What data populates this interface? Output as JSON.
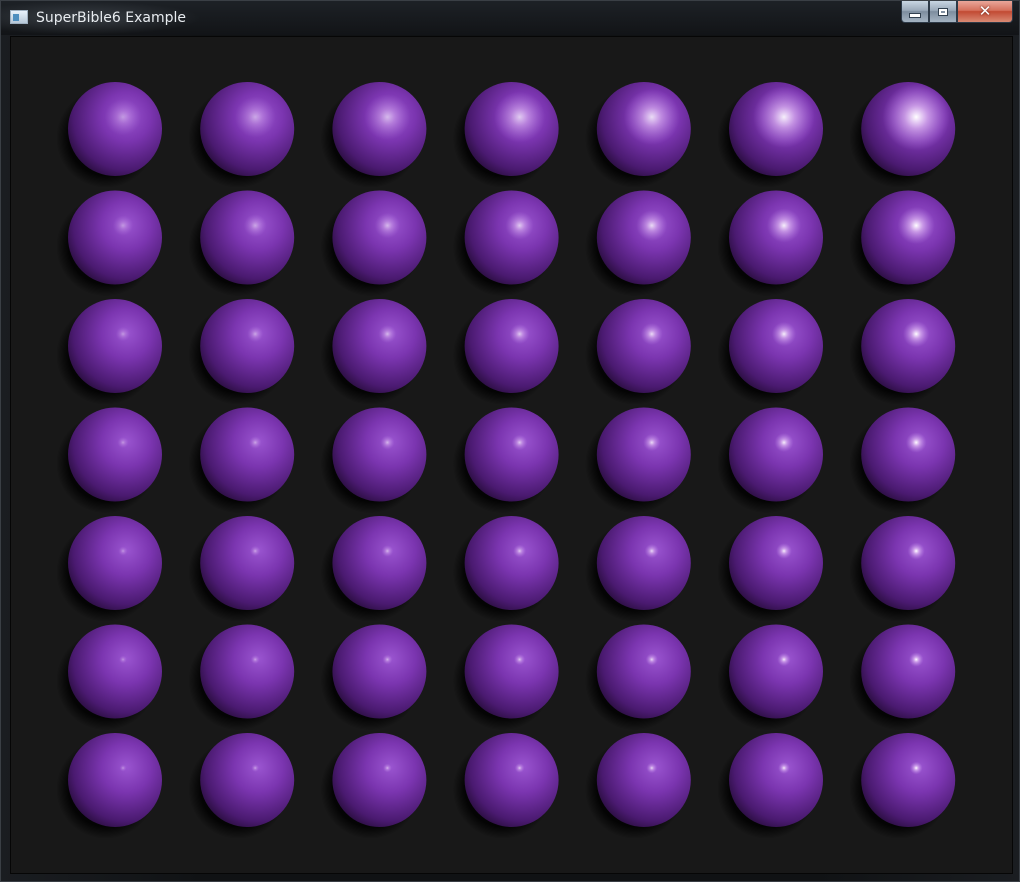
{
  "window": {
    "title": "SuperBible6 Example",
    "icon": "app-window-icon"
  },
  "caption_buttons": {
    "minimize": {
      "icon": "minimize-icon"
    },
    "maximize": {
      "icon": "maximize-icon"
    },
    "close": {
      "icon": "close-icon",
      "glyph": "✕"
    }
  },
  "scene": {
    "background_color": "#181818",
    "sphere_color": "#7b35b0",
    "highlight_color": "#ffffff",
    "rows": 7,
    "columns": 7,
    "specular_intensity_by_column": [
      0.1,
      0.22,
      0.36,
      0.5,
      0.64,
      0.8,
      0.95
    ],
    "specular_sharpness_by_row": [
      1,
      2,
      3,
      4,
      5,
      6,
      7
    ]
  }
}
